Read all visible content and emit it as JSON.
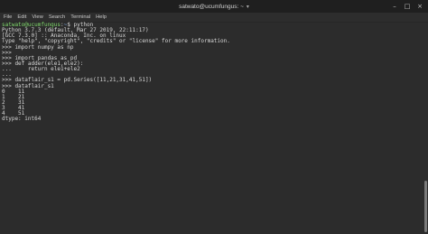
{
  "window": {
    "title": "satwato@ucumfungus: ~",
    "title_arrow": "▾",
    "controls": {
      "minimize": "–",
      "maximize": "□",
      "close": "×"
    }
  },
  "menu": [
    "File",
    "Edit",
    "View",
    "Search",
    "Terminal",
    "Help"
  ],
  "terminal": {
    "prompt": {
      "user": "satwato@ucumfungus",
      "sep": ":",
      "path": "~",
      "symbol": "$ ",
      "command": "python"
    },
    "lines": [
      "Python 3.7.3 (default, Mar 27 2019, 22:11:17)",
      "[GCC 7.3.0] :: Anaconda, Inc. on linux",
      "Type \"help\", \"copyright\", \"credits\" or \"license\" for more information.",
      ">>> import numpy as np",
      ">>>",
      ">>> import pandas as pd",
      ">>> def adder(ele1,ele2):",
      "...     return ele1+ele2",
      "...",
      ">>> dataflair_s1 = pd.Series([11,21,31,41,51])",
      ">>> dataflair_s1",
      "0    11",
      "1    21",
      "2    31",
      "3    41",
      "4    51",
      "dtype: int64"
    ]
  }
}
